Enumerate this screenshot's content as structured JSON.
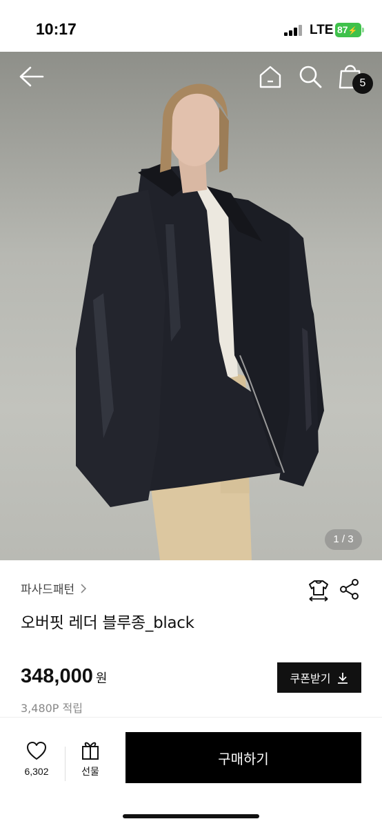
{
  "status_bar": {
    "time": "10:17",
    "network": "LTE",
    "battery": "87"
  },
  "header": {
    "icons": [
      "back-arrow-icon",
      "home-icon",
      "search-icon",
      "shopping-bag-icon"
    ],
    "cart_count": "5"
  },
  "gallery": {
    "indicator": "1 / 3"
  },
  "product": {
    "brand": "파사드패턴",
    "title": "오버핏 레더 블루종_black",
    "price": "348,000",
    "price_unit": "원",
    "points": "3,480P 적립",
    "coupon_label": "쿠폰받기"
  },
  "bottom_bar": {
    "like_count": "6,302",
    "gift_label": "선물",
    "buy_label": "구매하기"
  },
  "colors": {
    "accent": "#000000",
    "battery": "#3fc14b",
    "muted": "#888888"
  }
}
